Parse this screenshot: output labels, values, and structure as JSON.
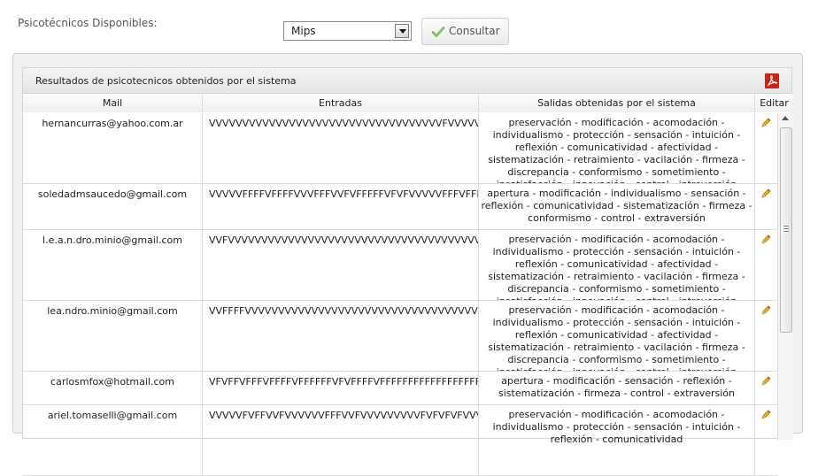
{
  "top_label": "Psicotécnicos Disponibles:",
  "select": {
    "value": "Mips"
  },
  "consult_button": {
    "label": "Consultar"
  },
  "panel": {
    "title": "Resultados de psicotecnicos obtenidos por el sistema"
  },
  "columns": {
    "mail": "Mail",
    "entradas": "Entradas",
    "salidas": "Salidas obtenidas por el sistema",
    "editar": "Editar"
  },
  "rows": [
    {
      "mail": "hernancurras@yahoo.com.ar",
      "entradas": "VVVVVVVVVVVVVVVVVVVVVVVVVVVVVVVVVVVFVVVVVVVVVVVVVV",
      "salidas": "preservación - modificación - acomodación - individualismo - protección - sensación - intuición - reflexión - comunicatividad - afectividad - sistematización - retraimiento - vacilación - firmeza - discrepancia - conformismo - sometimiento - insatisfacción - innovación - control - introversión"
    },
    {
      "mail": "soledadmsaucedo@gmail.com",
      "entradas": "VVVVVFFFFVFFFFVVVFFFVVFVFFFFFVFVFVVVVVFFFVFFFVVVF",
      "salidas": "apertura - modificación - individualismo - sensación - reflexión - comunicatividad - sistematización - firmeza - conformismo - control - extraversión"
    },
    {
      "mail": "l.e.a.n.dro.minio@gmail.com",
      "entradas": "VVFVVVVVVVVVVVVVVVVVVVVVVVVVVVVVVVVVVVVVVVVVVVVVVV",
      "salidas": "preservación - modificación - acomodación - individualismo - protección - sensación - intuición - reflexión - comunicatividad - afectividad - sistematización - retraimiento - vacilación - firmeza - discrepancia - conformismo - sometimiento - insatisfacción - innovación - control - introversión"
    },
    {
      "mail": "lea.ndro.minio@gmail.com",
      "entradas": "VVFFFFVVVVVVVVVVVVVVVVVVVVVVVVVVVVVVVVVVVVVVVVVVV",
      "salidas": "preservación - modificación - acomodación - individualismo - protección - sensación - intuición - reflexión - comunicatividad - afectividad - sistematización - retraimiento - vacilación - firmeza - discrepancia - conformismo - sometimiento - insatisfacción - innovación - control - introversión"
    },
    {
      "mail": "carlosmfox@hotmail.com",
      "entradas": "VFVFFVFFFVFFFFVFFFFFFVFVFFFFVFFFFFFFFFFFFFFFFFFFFV",
      "salidas": "apertura - modificación - sensación - reflexión - sistematización - firmeza - control - extraversión"
    },
    {
      "mail": "ariel.tomaselli@gmail.com",
      "entradas": "VVVVVFVFFVVFVVVVVVFFFVVFVVVVVVVVVFVFVFVFVVVVVVVVVV",
      "salidas": "preservación - modificación - acomodación - individualismo - protección - sensación - intuición - reflexión - comunicatividad"
    }
  ]
}
